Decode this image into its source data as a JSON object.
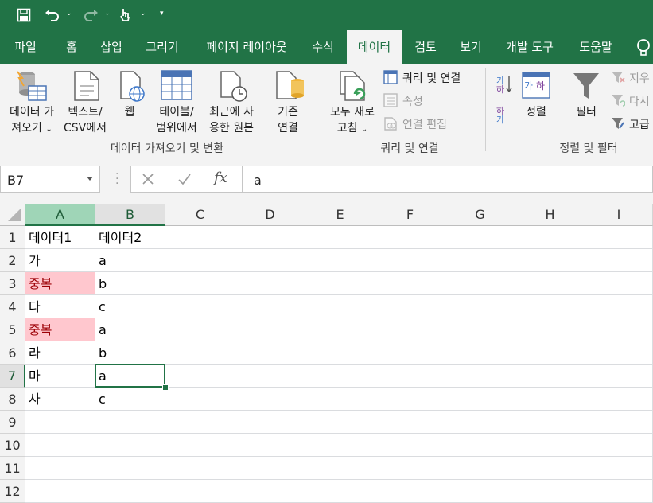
{
  "qat": {
    "save_icon": "save-icon",
    "undo_icon": "undo-icon",
    "redo_icon": "redo-icon",
    "touch_icon": "touch-mode-icon",
    "customize_icon": "customize-qat-icon"
  },
  "tabs": [
    {
      "label": "파일"
    },
    {
      "label": "홈"
    },
    {
      "label": "삽입"
    },
    {
      "label": "그리기"
    },
    {
      "label": "페이지 레이아웃"
    },
    {
      "label": "수식"
    },
    {
      "label": "데이터",
      "active": true
    },
    {
      "label": "검토"
    },
    {
      "label": "보기"
    },
    {
      "label": "개발 도구"
    },
    {
      "label": "도움말"
    }
  ],
  "ribbon": {
    "get_data": {
      "line1": "데이터 가",
      "line2": "져오기"
    },
    "text_csv": {
      "line1": "텍스트/",
      "line2": "CSV에서"
    },
    "web": {
      "line1": "웹"
    },
    "table_range": {
      "line1": "테이블/",
      "line2": "범위에서"
    },
    "recent_sources": {
      "line1": "최근에 사",
      "line2": "용한 원본"
    },
    "existing_conn": {
      "line1": "기존",
      "line2": "연결"
    },
    "group1_title": "데이터 가져오기 및 변환",
    "refresh_all": {
      "line1": "모두 새로",
      "line2": "고침"
    },
    "queries_connections": "쿼리 및 연결",
    "properties": "속성",
    "edit_links": "연결 편집",
    "group2_title": "쿼리 및 연결",
    "sort": "정렬",
    "filter": "필터",
    "clear": "지우",
    "reapply": "다시",
    "advanced": "고급",
    "group3_title": "정렬 및 필터"
  },
  "formula_bar": {
    "name_box": "B7",
    "formula": "a",
    "fx": "fx"
  },
  "columns": [
    "A",
    "B",
    "C",
    "D",
    "E",
    "F",
    "G",
    "H",
    "I"
  ],
  "rows": [
    "1",
    "2",
    "3",
    "4",
    "5",
    "6",
    "7",
    "8",
    "9",
    "10",
    "11",
    "12"
  ],
  "cells": {
    "A": [
      "데이터1",
      "가",
      "중복",
      "다",
      "중복",
      "라",
      "마",
      "사"
    ],
    "B": [
      "데이터2",
      "a",
      "b",
      "c",
      "a",
      "b",
      "a",
      "c"
    ]
  },
  "colors": {
    "accent": "#217346",
    "duplicate_fill": "#ffc7ce",
    "duplicate_text": "#9c0006"
  }
}
